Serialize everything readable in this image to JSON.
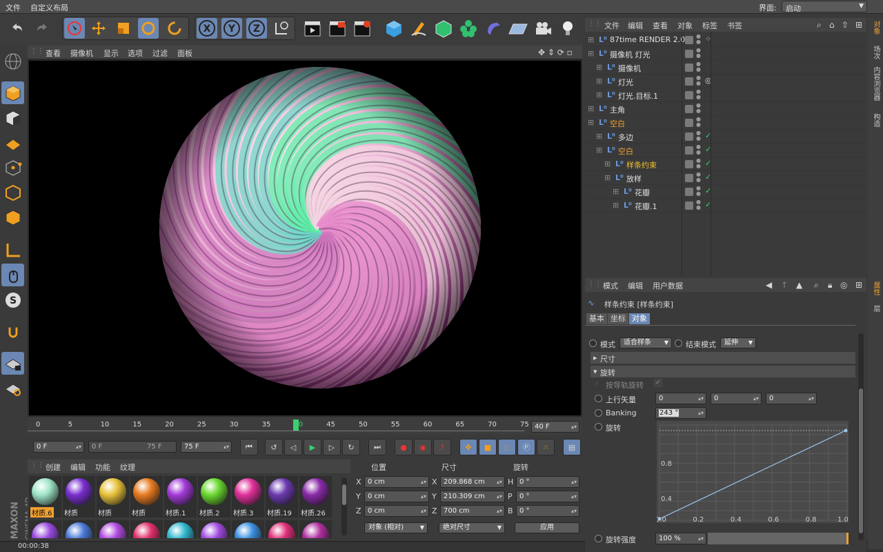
{
  "menubar": {
    "file": "文件",
    "custom_layout": "自定义布局",
    "interface_label": "界面:",
    "interface_value": "启动"
  },
  "viewport": {
    "menu": [
      "查看",
      "摄像机",
      "显示",
      "选项",
      "过滤",
      "面板"
    ]
  },
  "timeline": {
    "ticks": [
      "0",
      "5",
      "10",
      "15",
      "20",
      "25",
      "30",
      "35",
      "40",
      "45",
      "50",
      "55",
      "60",
      "65",
      "70",
      "75"
    ],
    "current_frame": "40",
    "end_field": "40 F"
  },
  "playback": {
    "start": "0 F",
    "range_start": "0 F",
    "range_end": "75 F",
    "end": "75 F"
  },
  "materials": {
    "menu": [
      "创建",
      "编辑",
      "功能",
      "纹理"
    ],
    "items": [
      {
        "label": "材质.6",
        "color": "#9fe6c8",
        "active": true
      },
      {
        "label": "材质",
        "color": "#7a2fd0",
        "active": false
      },
      {
        "label": "材质",
        "color": "#e8c23a",
        "active": false
      },
      {
        "label": "材质",
        "color": "#e87a20",
        "active": false
      },
      {
        "label": "材质.1",
        "color": "#a23ad8",
        "active": false
      },
      {
        "label": "材质.2",
        "color": "#6ad830",
        "active": false
      },
      {
        "label": "材质.3",
        "color": "#e0309a",
        "active": false
      },
      {
        "label": "材质.19",
        "color": "#6b3ab0",
        "active": false
      },
      {
        "label": "材质.26",
        "color": "#8a2aa8",
        "active": false
      }
    ],
    "row2_colors": [
      "#9a4ae0",
      "#4a7ad8",
      "#b04ae0",
      "#e0306a",
      "#30b8d0",
      "#a04ae0",
      "#3a90e0",
      "#e0307a",
      "#b030a0"
    ]
  },
  "coords": {
    "headers": {
      "position": "位置",
      "size": "尺寸",
      "rotation": "旋转"
    },
    "rows": [
      {
        "axis": "X",
        "pos": "0 cm",
        "saxis": "X",
        "size": "209.868 cm",
        "raxis": "H",
        "rot": "0 °"
      },
      {
        "axis": "Y",
        "pos": "0 cm",
        "saxis": "Y",
        "size": "210.309 cm",
        "raxis": "P",
        "rot": "0 °"
      },
      {
        "axis": "Z",
        "pos": "0 cm",
        "saxis": "Z",
        "size": "700 cm",
        "raxis": "B",
        "rot": "0 °"
      }
    ],
    "mode": "对象 (相对)",
    "size_mode": "绝对尺寸",
    "apply": "应用"
  },
  "status": {
    "time": "00:00:38"
  },
  "objects": {
    "menu": [
      "文件",
      "编辑",
      "查看",
      "对象",
      "标签",
      "书签"
    ],
    "rows": [
      {
        "name": "87time RENDER 2.0",
        "indent": 0,
        "color": "#e0e0e0",
        "tag": "⁘"
      },
      {
        "name": "摄像机 灯光",
        "indent": 0,
        "color": "#e0e0e0",
        "tag": ""
      },
      {
        "name": "摄像机",
        "indent": 1,
        "color": "#e0e0e0",
        "tag": ""
      },
      {
        "name": "灯光",
        "indent": 1,
        "color": "#e0e0e0",
        "tag": "◎"
      },
      {
        "name": "灯光.目标.1",
        "indent": 1,
        "color": "#e0e0e0",
        "tag": ""
      },
      {
        "name": "主角",
        "indent": 0,
        "color": "#e0e0e0",
        "tag": ""
      },
      {
        "name": "空白",
        "indent": 0,
        "color": "#f0a030",
        "tag": ""
      },
      {
        "name": "多边",
        "indent": 1,
        "color": "#e0e0e0",
        "tag": "✓"
      },
      {
        "name": "空白",
        "indent": 1,
        "color": "#f0a030",
        "tag": "✓"
      },
      {
        "name": "样条约束",
        "indent": 2,
        "color": "#f0c030",
        "tag": "✓"
      },
      {
        "name": "放样",
        "indent": 2,
        "color": "#e0e0e0",
        "tag": "✓"
      },
      {
        "name": "花瓣",
        "indent": 3,
        "color": "#e0e0e0",
        "tag": "✓"
      },
      {
        "name": "花瓣.1",
        "indent": 3,
        "color": "#e0e0e0",
        "tag": "✓"
      }
    ]
  },
  "attributes": {
    "menu": [
      "模式",
      "编辑",
      "用户数据"
    ],
    "title": "样条约束 [样条约束]",
    "tabs": [
      "基本",
      "坐标",
      "对象"
    ],
    "mode_label": "模式",
    "mode_value": "适合样条",
    "end_mode_label": "结束模式",
    "end_mode_value": "延伸",
    "section_size": "尺寸",
    "section_rotation": "旋转",
    "rail_rotation": "按导轨旋转",
    "up_vector": "上行矢量",
    "up_values": [
      "0",
      "0",
      "0"
    ],
    "banking_label": "Banking",
    "banking_value": "243 °",
    "rotation_label": "旋转",
    "graph_y": [
      "0.8",
      "0.4"
    ],
    "graph_x": [
      "0.0",
      "0.2",
      "0.4",
      "0.6",
      "0.8",
      "1.0"
    ],
    "rotation_strength_label": "旋转强度",
    "rotation_strength_value": "100 %"
  },
  "sidetabs": [
    "对象",
    "场次",
    "内容浏览器",
    "构造"
  ],
  "sidetabs2": [
    "属性",
    "层"
  ],
  "brand": {
    "maxon": "MAXON",
    "product": "CINEMA 4D"
  }
}
